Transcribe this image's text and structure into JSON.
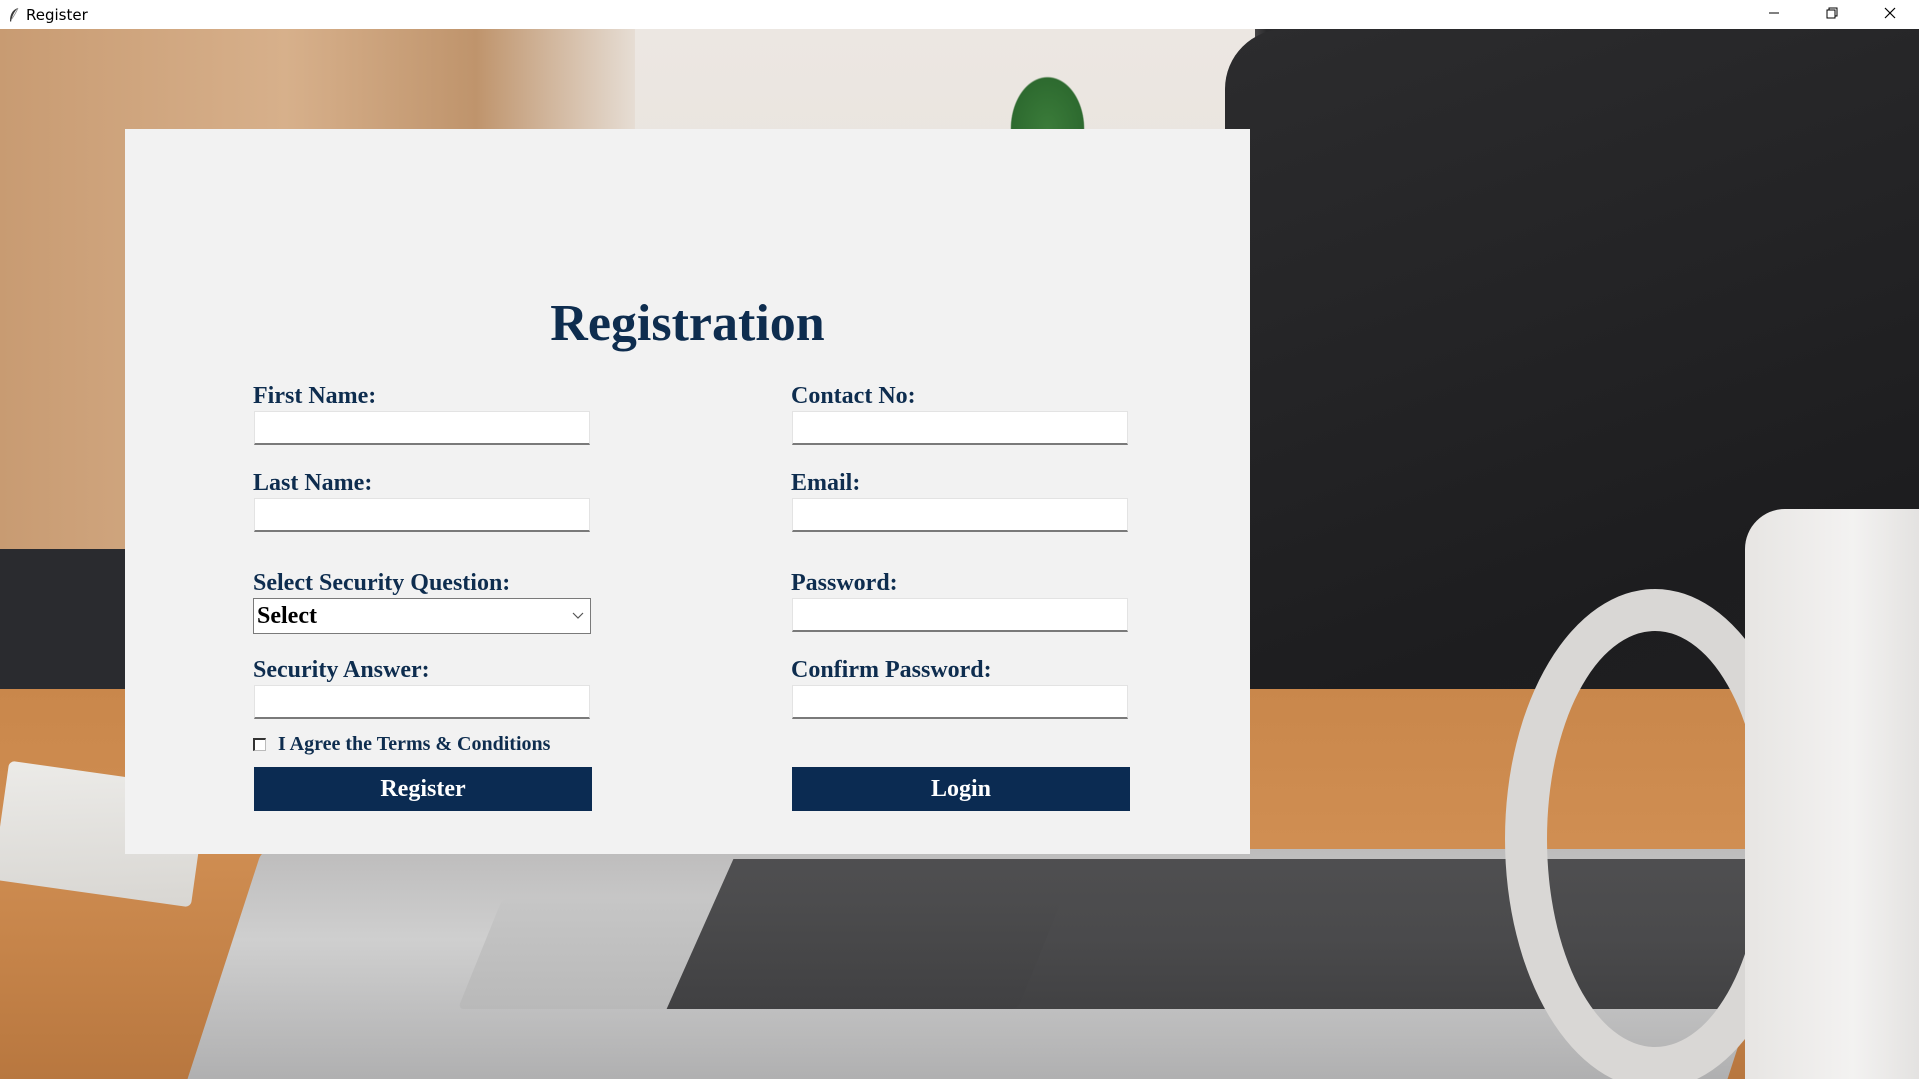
{
  "window": {
    "title": "Register",
    "controls": [
      "minimize-icon",
      "restore-icon",
      "close-icon"
    ]
  },
  "form": {
    "title": "Registration",
    "left_column": {
      "first_name": {
        "label": "First Name:",
        "value": ""
      },
      "last_name": {
        "label": "Last Name:",
        "value": ""
      },
      "security_question": {
        "label": "Select Security Question:",
        "selected": "Select"
      },
      "security_answer": {
        "label": "Security Answer:",
        "value": ""
      }
    },
    "right_column": {
      "contact_no": {
        "label": "Contact No:",
        "value": ""
      },
      "email": {
        "label": "Email:",
        "value": ""
      },
      "password": {
        "label": "Password:",
        "value": ""
      },
      "confirm_password": {
        "label": "Confirm Password:",
        "value": ""
      }
    },
    "terms": {
      "label": "I Agree the Terms & Conditions",
      "checked": false
    },
    "buttons": {
      "register": "Register",
      "login": "Login"
    }
  },
  "colors": {
    "accent": "#0b2b52",
    "label": "#0e2d4f",
    "panel": "#f2f2f2"
  }
}
